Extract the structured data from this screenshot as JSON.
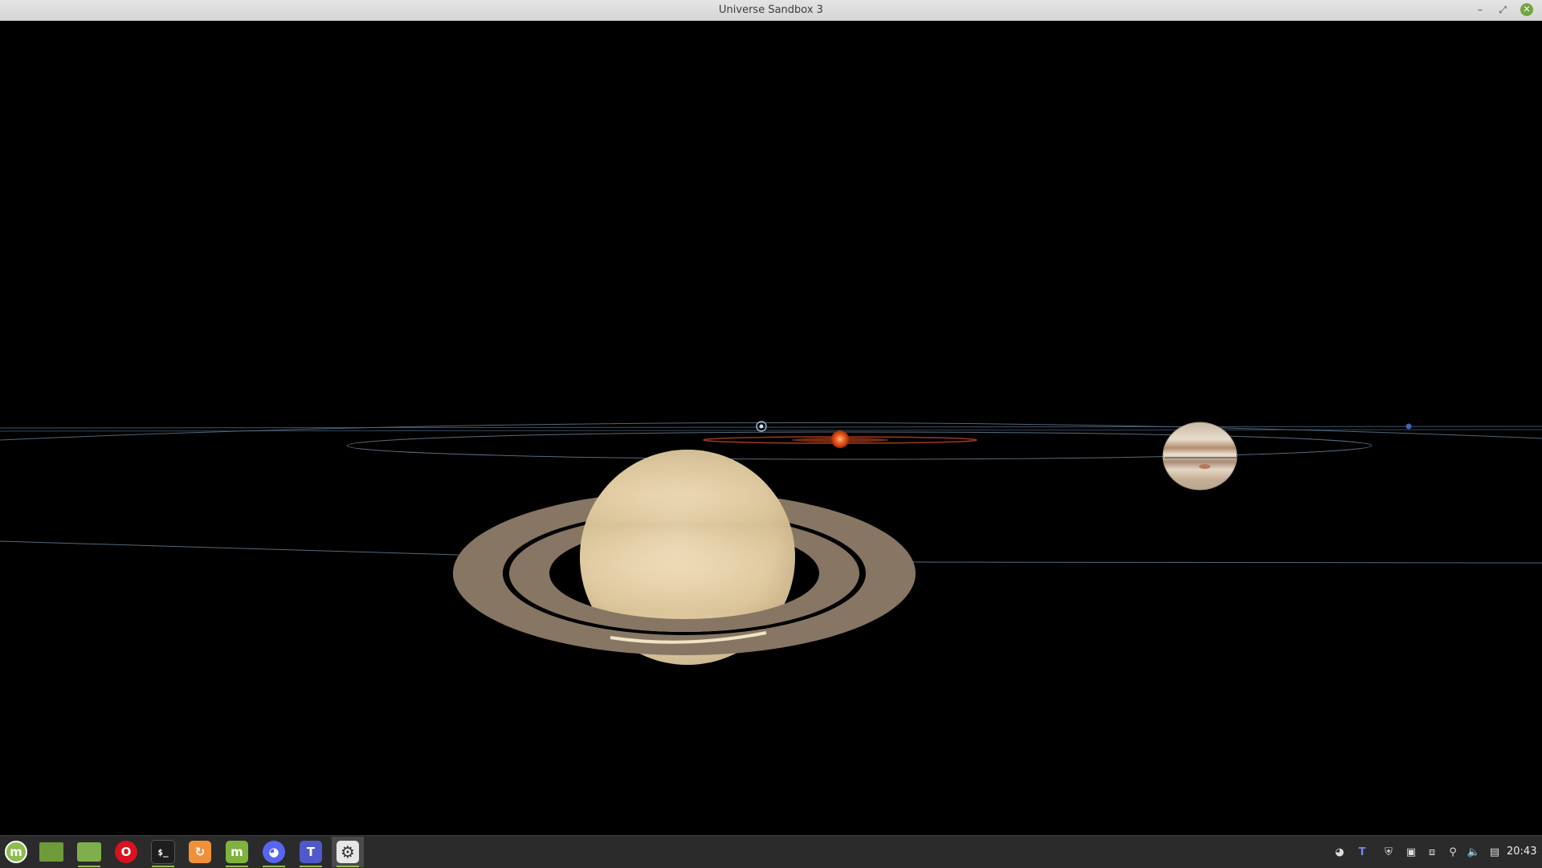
{
  "window": {
    "title": "Universe Sandbox 3",
    "buttons": {
      "minimize": "–",
      "maximize": "⤢",
      "close": "✕"
    }
  },
  "scene": {
    "bodies": [
      {
        "name": "Saturn",
        "icon": "saturn-planet"
      },
      {
        "name": "Jupiter",
        "icon": "jupiter-planet"
      },
      {
        "name": "Sun",
        "icon": "sun-star"
      },
      {
        "name": "Earth",
        "icon": "earth-marker"
      },
      {
        "name": "Neptune",
        "icon": "neptune-marker"
      }
    ]
  },
  "taskbar": {
    "apps": [
      {
        "id": "menu",
        "icon": "linux-mint-menu-icon",
        "glyph": "m",
        "color": "#8dbc4f"
      },
      {
        "id": "show-desktop",
        "icon": "show-desktop-icon",
        "glyph": "",
        "color": "#6e9a3a"
      },
      {
        "id": "files",
        "icon": "folder-icon",
        "glyph": "",
        "color": "#7fae4c"
      },
      {
        "id": "opera",
        "icon": "opera-icon",
        "glyph": "O",
        "color": "#d8121f"
      },
      {
        "id": "terminal",
        "icon": "terminal-icon",
        "glyph": "$_",
        "color": "#1e1e1e"
      },
      {
        "id": "software-sources",
        "icon": "refresh-arrow-icon",
        "glyph": "↻",
        "color": "#f0913a"
      },
      {
        "id": "mint-update",
        "icon": "mint-update-icon",
        "glyph": "m",
        "color": "#7fb33d"
      },
      {
        "id": "discord",
        "icon": "discord-icon",
        "glyph": "◕",
        "color": "#5865f2"
      },
      {
        "id": "teams",
        "icon": "teams-icon",
        "glyph": "T",
        "color": "#5059c9"
      },
      {
        "id": "universe-sandbox",
        "icon": "gear-icon",
        "glyph": "⚙",
        "color": "#cccccc"
      }
    ],
    "tray": [
      {
        "icon": "discord-tray-icon",
        "glyph": "◕"
      },
      {
        "icon": "teams-tray-icon",
        "glyph": "T"
      },
      {
        "icon": "shield-icon",
        "glyph": "⛨"
      },
      {
        "icon": "camera-icon",
        "glyph": "▣"
      },
      {
        "icon": "screenshot-icon",
        "glyph": "⧈"
      },
      {
        "icon": "network-icon",
        "glyph": "⚲"
      },
      {
        "icon": "volume-icon",
        "glyph": "🔈"
      },
      {
        "icon": "clipboard-icon",
        "glyph": "▤"
      }
    ],
    "clock": "20:43"
  },
  "colors": {
    "taskbar_bg": "#2b2b2b",
    "accent": "#8dbc4f",
    "space_bg": "#000000"
  }
}
